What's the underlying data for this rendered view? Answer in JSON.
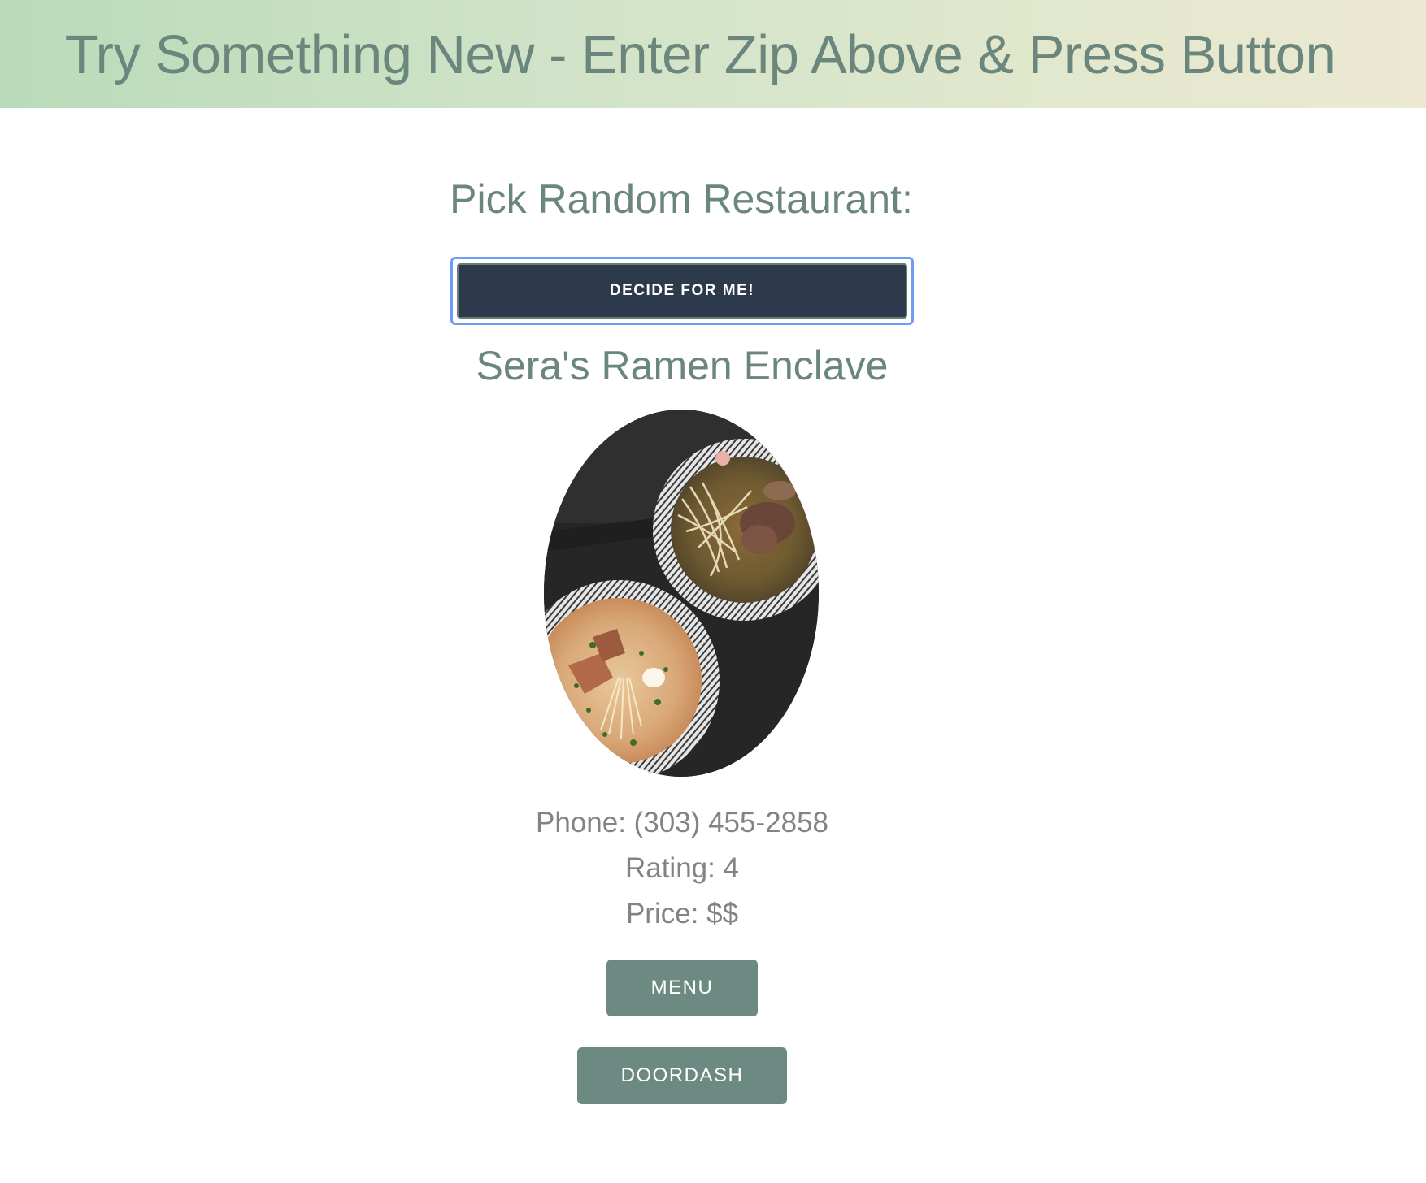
{
  "banner": {
    "title": "Try Something New - Enter Zip Above & Press Button"
  },
  "picker": {
    "heading": "Pick Random Restaurant:",
    "decide_label": "DECIDE FOR ME!"
  },
  "restaurant": {
    "name": "Sera's Ramen Enclave",
    "photo_icon": "ramen-bowls-photo",
    "phone": "Phone: (303) 455-2858",
    "rating": "Rating: 4",
    "price": "Price: $$",
    "menu_label": "MENU",
    "doordash_label": "DOORDASH"
  },
  "colors": {
    "banner_gradient_start": "#b9dbb9",
    "banner_gradient_end": "#ece8d2",
    "heading_text": "#6b877d",
    "decide_button": "#2c3a4b",
    "focus_ring": "#6f9cf4",
    "action_button": "#6d8a82",
    "info_text": "#838383"
  }
}
